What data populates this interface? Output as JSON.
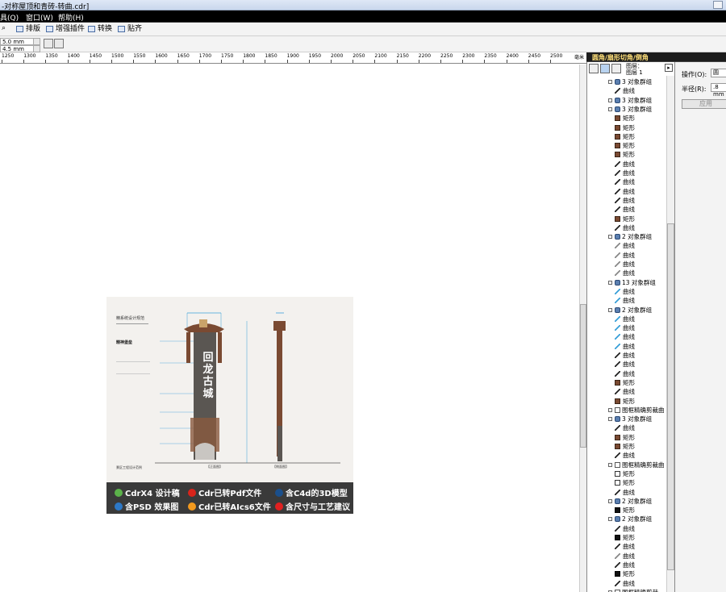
{
  "title": "-对称屋顶和青砖-转曲.cdr]",
  "menu": [
    "具(Q)",
    "窗口(W)",
    "帮助(H)"
  ],
  "toolbar": {
    "buttons": [
      "排版",
      "增强插件",
      "转换",
      "贴齐"
    ]
  },
  "propbar": {
    "nudge1": "5.0 mm",
    "nudge2": "4.5 mm"
  },
  "ruler": {
    "labels": [
      "1250",
      "1300",
      "1350",
      "1400",
      "1450",
      "1500",
      "1550",
      "1600",
      "1650",
      "1700",
      "1750",
      "1800",
      "1850",
      "1900",
      "1950",
      "2000",
      "2050",
      "2100",
      "2150",
      "2200",
      "2250",
      "2300",
      "2350",
      "2400",
      "2450",
      "2500"
    ],
    "unit": "毫米"
  },
  "poster": {
    "heading": "精系统设计规范",
    "subtitle": "精神堡垒",
    "sign_text": "回龙古城",
    "footer_small": "景区工程设计范例",
    "front_label": "【正面图】",
    "side_label": "【侧面图】",
    "features": [
      {
        "icon": "cdr-icon",
        "color": "#5bb24a",
        "text": "CdrX4 设计稿"
      },
      {
        "icon": "pdf-icon",
        "color": "#d9241b",
        "text": "Cdr已转Pdf文件"
      },
      {
        "icon": "c4d-icon",
        "color": "#1a4f8c",
        "text": "含C4d的3D模型"
      },
      {
        "icon": "ps-icon",
        "color": "#2d78c6",
        "text": "含PSD 效果图"
      },
      {
        "icon": "ai-icon",
        "color": "#f39a1e",
        "text": "Cdr已转AIcs6文件"
      },
      {
        "icon": "warn-icon",
        "color": "#e02020",
        "text": "含尺寸与工艺建议"
      }
    ]
  },
  "docker": {
    "title": "圆角/扇形切角/倒角",
    "layer_label_1": "图层：",
    "layer_label_2": "图层 1",
    "object_rows": [
      {
        "indent": 1,
        "expand": true,
        "swatch": "group",
        "label": "3 对象群组"
      },
      {
        "indent": 2,
        "expand": false,
        "swatch": "curve",
        "label": "曲线"
      },
      {
        "indent": 1,
        "expand": true,
        "swatch": "group",
        "label": "3 对象群组"
      },
      {
        "indent": 1,
        "expand": true,
        "swatch": "group",
        "label": "3 对象群组"
      },
      {
        "indent": 2,
        "expand": false,
        "swatch": "brown",
        "label": "矩形"
      },
      {
        "indent": 2,
        "expand": false,
        "swatch": "brown",
        "label": "矩形"
      },
      {
        "indent": 2,
        "expand": false,
        "swatch": "brown",
        "label": "矩形"
      },
      {
        "indent": 2,
        "expand": false,
        "swatch": "brown",
        "label": "矩形"
      },
      {
        "indent": 2,
        "expand": false,
        "swatch": "brown",
        "label": "矩形"
      },
      {
        "indent": 2,
        "expand": false,
        "swatch": "curve",
        "label": "曲线"
      },
      {
        "indent": 2,
        "expand": false,
        "swatch": "curve",
        "label": "曲线"
      },
      {
        "indent": 2,
        "expand": false,
        "swatch": "curve",
        "label": "曲线"
      },
      {
        "indent": 2,
        "expand": false,
        "swatch": "curve",
        "label": "曲线"
      },
      {
        "indent": 2,
        "expand": false,
        "swatch": "curve",
        "label": "曲线"
      },
      {
        "indent": 2,
        "expand": false,
        "swatch": "curve",
        "label": "曲线"
      },
      {
        "indent": 2,
        "expand": false,
        "swatch": "brown",
        "label": "矩形"
      },
      {
        "indent": 2,
        "expand": false,
        "swatch": "curve",
        "label": "曲线"
      },
      {
        "indent": 1,
        "expand": true,
        "swatch": "group",
        "label": "2 对象群组"
      },
      {
        "indent": 2,
        "expand": false,
        "swatch": "curve-light",
        "label": "曲线"
      },
      {
        "indent": 2,
        "expand": false,
        "swatch": "curve-light",
        "label": "曲线"
      },
      {
        "indent": 2,
        "expand": false,
        "swatch": "curve-light",
        "label": "曲线"
      },
      {
        "indent": 2,
        "expand": false,
        "swatch": "curve-light",
        "label": "曲线"
      },
      {
        "indent": 1,
        "expand": true,
        "swatch": "group",
        "label": "13 对象群组"
      },
      {
        "indent": 2,
        "expand": false,
        "swatch": "curve-blue",
        "label": "曲线"
      },
      {
        "indent": 2,
        "expand": false,
        "swatch": "curve-blue",
        "label": "曲线"
      },
      {
        "indent": 1,
        "expand": true,
        "swatch": "group",
        "label": "2 对象群组"
      },
      {
        "indent": 2,
        "expand": false,
        "swatch": "curve-blue",
        "label": "曲线"
      },
      {
        "indent": 2,
        "expand": false,
        "swatch": "curve-blue",
        "label": "曲线"
      },
      {
        "indent": 2,
        "expand": false,
        "swatch": "curve-blue",
        "label": "曲线"
      },
      {
        "indent": 2,
        "expand": false,
        "swatch": "curve-blue",
        "label": "曲线"
      },
      {
        "indent": 2,
        "expand": false,
        "swatch": "curve",
        "label": "曲线"
      },
      {
        "indent": 2,
        "expand": false,
        "swatch": "curve",
        "label": "曲线"
      },
      {
        "indent": 2,
        "expand": false,
        "swatch": "curve",
        "label": "曲线"
      },
      {
        "indent": 2,
        "expand": false,
        "swatch": "brown",
        "label": "矩形"
      },
      {
        "indent": 2,
        "expand": false,
        "swatch": "curve",
        "label": "曲线"
      },
      {
        "indent": 2,
        "expand": false,
        "swatch": "brown",
        "label": "矩形"
      },
      {
        "indent": 1,
        "expand": true,
        "swatch": "clip",
        "label": "图框精确剪裁曲"
      },
      {
        "indent": 1,
        "expand": true,
        "swatch": "group",
        "label": "3 对象群组"
      },
      {
        "indent": 2,
        "expand": false,
        "swatch": "curve",
        "label": "曲线"
      },
      {
        "indent": 2,
        "expand": false,
        "swatch": "brown",
        "label": "矩形"
      },
      {
        "indent": 2,
        "expand": false,
        "swatch": "brown",
        "label": "矩形"
      },
      {
        "indent": 2,
        "expand": false,
        "swatch": "curve",
        "label": "曲线"
      },
      {
        "indent": 1,
        "expand": true,
        "swatch": "clip",
        "label": "图框精确剪裁曲"
      },
      {
        "indent": 2,
        "expand": false,
        "swatch": "white",
        "label": "矩形"
      },
      {
        "indent": 2,
        "expand": false,
        "swatch": "white",
        "label": "矩形"
      },
      {
        "indent": 2,
        "expand": false,
        "swatch": "curve",
        "label": "曲线"
      },
      {
        "indent": 1,
        "expand": true,
        "swatch": "group",
        "label": "2 对象群组"
      },
      {
        "indent": 2,
        "expand": false,
        "swatch": "black",
        "label": "矩形"
      },
      {
        "indent": 1,
        "expand": true,
        "swatch": "group",
        "label": "2 对象群组"
      },
      {
        "indent": 2,
        "expand": false,
        "swatch": "curve",
        "label": "曲线"
      },
      {
        "indent": 2,
        "expand": false,
        "swatch": "black",
        "label": "矩形"
      },
      {
        "indent": 2,
        "expand": false,
        "swatch": "curve",
        "label": "曲线"
      },
      {
        "indent": 2,
        "expand": false,
        "swatch": "curve-light",
        "label": "曲线"
      },
      {
        "indent": 2,
        "expand": false,
        "swatch": "curve",
        "label": "曲线"
      },
      {
        "indent": 2,
        "expand": false,
        "swatch": "black",
        "label": "矩形"
      },
      {
        "indent": 2,
        "expand": false,
        "swatch": "curve",
        "label": "曲线"
      },
      {
        "indent": 1,
        "expand": true,
        "swatch": "clip",
        "label": "图框精确剪裁"
      }
    ]
  },
  "rightpanel": {
    "op_label": "操作(O):",
    "op_value": "圆",
    "radius_label": "半径(R):",
    "radius_value": ".8 mm",
    "apply_label": "应用"
  },
  "colors": {
    "brown": "#7a4a32",
    "group_icon": "#5b7fb0",
    "accent_blue": "#3aa0d8"
  }
}
